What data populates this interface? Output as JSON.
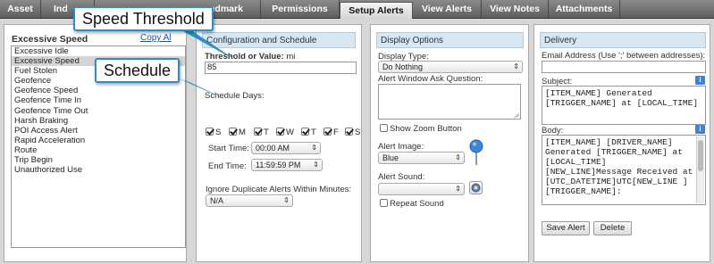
{
  "tabs": [
    {
      "label": "Asset"
    },
    {
      "label": "Ind"
    },
    {
      "label": "ndmark"
    },
    {
      "label": "Permissions"
    },
    {
      "label": "Setup Alerts",
      "active": true
    },
    {
      "label": "View Alerts"
    },
    {
      "label": "View Notes"
    },
    {
      "label": "Attachments"
    }
  ],
  "alerts_panel": {
    "title": "Excessive Speed",
    "copy_link": "Copy Al",
    "items": [
      {
        "label": "Excessive Idle"
      },
      {
        "label": "Excessive Speed",
        "selected": true
      },
      {
        "label": "Fuel Stolen"
      },
      {
        "label": "Geofence"
      },
      {
        "label": "Geofence Speed"
      },
      {
        "label": "Geofence Time In"
      },
      {
        "label": "Geofence Time Out"
      },
      {
        "label": "Harsh Braking"
      },
      {
        "label": "POI Access Alert"
      },
      {
        "label": "Rapid Acceleration"
      },
      {
        "label": "Route"
      },
      {
        "label": "Trip Begin"
      },
      {
        "label": "Unauthorized Use"
      }
    ]
  },
  "config": {
    "header": "Configuration and Schedule",
    "threshold_label": "Threshold or Value:",
    "threshold_unit": "mi",
    "threshold_value": "85",
    "schedule_label": "Schedule Days:",
    "days": [
      {
        "label": "S",
        "checked": true
      },
      {
        "label": "M",
        "checked": true
      },
      {
        "label": "T",
        "checked": true
      },
      {
        "label": "W",
        "checked": true
      },
      {
        "label": "T",
        "checked": true
      },
      {
        "label": "F",
        "checked": true
      },
      {
        "label": "S",
        "checked": true
      }
    ],
    "start_label": "Start Time:",
    "start_value": "00:00 AM",
    "end_label": "End Time:",
    "end_value": "11:59:59 PM",
    "ignore_label": "Ignore Duplicate Alerts Within Minutes:",
    "ignore_value": "N/A"
  },
  "display": {
    "header": "Display Options",
    "type_label": "Display Type:",
    "type_value": "Do Nothing",
    "question_label": "Alert Window Ask Question:",
    "zoom_label": "Show Zoom Button",
    "image_label": "Alert Image:",
    "image_value": "Blue",
    "sound_label": "Alert Sound:",
    "sound_value": "",
    "repeat_label": "Repeat Sound",
    "pin_color": "#3a86d9"
  },
  "delivery": {
    "header": "Delivery",
    "email_label": "Email Address (Use ';' between addresses):",
    "email_value": "",
    "subject_label": "Subject:",
    "subject_value": "[ITEM_NAME] Generated [TRIGGER_NAME] at [LOCAL_TIME]",
    "body_label": "Body:",
    "body_value": "[ITEM_NAME] [DRIVER_NAME] Generated [TRIGGER_NAME] at [LOCAL_TIME] [NEW_LINE]Message Received at [UTC_DATETIME]UTC[NEW_LINE ][TRIGGER_NAME]:",
    "save_label": "Save Alert",
    "delete_label": "Delete",
    "info_glyph": "i"
  },
  "callouts": {
    "speed": "Speed Threshold",
    "schedule": "Schedule"
  }
}
